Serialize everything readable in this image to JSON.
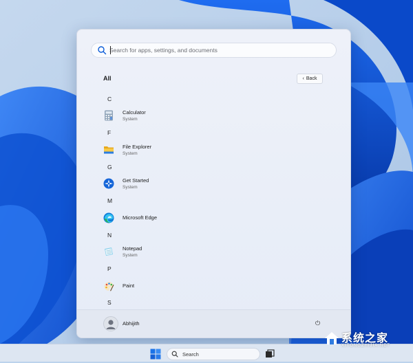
{
  "search": {
    "placeholder": "Search for apps, settings, and documents"
  },
  "section": {
    "title": "All",
    "back_label": "Back"
  },
  "groups": [
    {
      "letter": "C",
      "apps": [
        {
          "name": "Calculator",
          "sub": "System",
          "icon": "calculator-icon"
        }
      ]
    },
    {
      "letter": "F",
      "apps": [
        {
          "name": "File Explorer",
          "sub": "System",
          "icon": "folder-icon"
        }
      ]
    },
    {
      "letter": "G",
      "apps": [
        {
          "name": "Get Started",
          "sub": "System",
          "icon": "get-started-icon"
        }
      ]
    },
    {
      "letter": "M",
      "apps": [
        {
          "name": "Microsoft Edge",
          "sub": "",
          "icon": "edge-icon"
        }
      ]
    },
    {
      "letter": "N",
      "apps": [
        {
          "name": "Notepad",
          "sub": "System",
          "icon": "notepad-icon"
        }
      ]
    },
    {
      "letter": "P",
      "apps": [
        {
          "name": "Paint",
          "sub": "",
          "icon": "paint-icon"
        }
      ]
    },
    {
      "letter": "S",
      "apps": []
    }
  ],
  "user": {
    "name": "Abhijith"
  },
  "power": {
    "symbol": "⏻"
  },
  "taskbar": {
    "search_label": "Search"
  },
  "watermark": {
    "title": "系统之家",
    "sub": "XITONGZHIJIA.NET"
  },
  "colors": {
    "accent": "#0a5bd8",
    "wallpaper": "#bcd3ec"
  }
}
